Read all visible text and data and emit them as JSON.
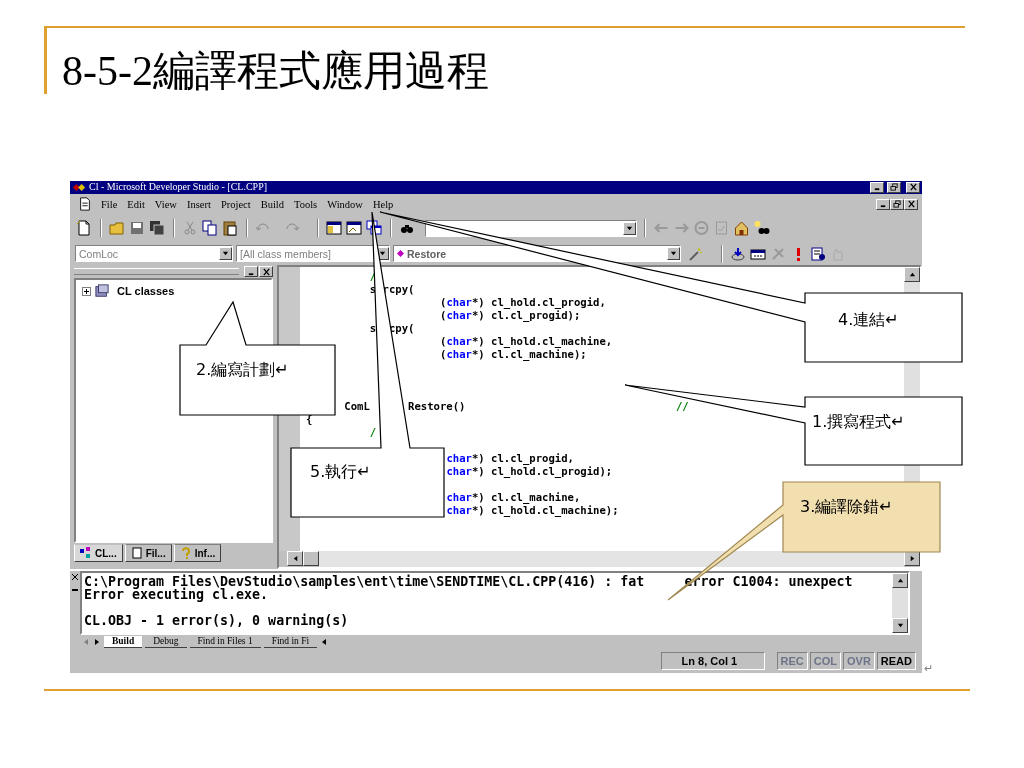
{
  "slide": {
    "title": "8-5-2編譯程式應用過程"
  },
  "window": {
    "title": "Cl - Microsoft Developer Studio - [CL.CPP]"
  },
  "menu": [
    "File",
    "Edit",
    "View",
    "Insert",
    "Project",
    "Build",
    "Tools",
    "Window",
    "Help"
  ],
  "combos": [
    {
      "value": "ComLoc"
    },
    {
      "value": "[All class members]"
    },
    {
      "value": "Restore"
    }
  ],
  "workspace": {
    "tree": [
      {
        "label": "CL classes",
        "expanded": false
      }
    ],
    "tabs": [
      {
        "label": "CL...",
        "selected": true
      },
      {
        "label": "Fil...",
        "selected": false
      },
      {
        "label": "Inf...",
        "selected": false
      }
    ]
  },
  "editor": {
    "lines": [
      {
        "kind": "code",
        "parts": [
          {
            "text": "          /",
            "kind": "comment"
          }
        ]
      },
      {
        "kind": "code",
        "parts": [
          {
            "text": "          s rcpy(",
            "kind": "plain"
          }
        ]
      },
      {
        "kind": "code",
        "parts": [
          {
            "text": "                     (",
            "kind": "plain"
          },
          {
            "text": "char",
            "kind": "keyword"
          },
          {
            "text": "*) cl_hold.cl_progid,",
            "kind": "plain"
          }
        ]
      },
      {
        "kind": "code",
        "parts": [
          {
            "text": "                     (",
            "kind": "plain"
          },
          {
            "text": "char",
            "kind": "keyword"
          },
          {
            "text": "*) cl.cl_progid);",
            "kind": "plain"
          }
        ]
      },
      {
        "kind": "code",
        "parts": [
          {
            "text": "          s  cpy(",
            "kind": "plain"
          }
        ]
      },
      {
        "kind": "code",
        "parts": [
          {
            "text": "                     (",
            "kind": "plain"
          },
          {
            "text": "char",
            "kind": "keyword"
          },
          {
            "text": "*) cl_hold.cl_machine,",
            "kind": "plain"
          }
        ]
      },
      {
        "kind": "code",
        "parts": [
          {
            "text": "                     (",
            "kind": "plain"
          },
          {
            "text": "char",
            "kind": "keyword"
          },
          {
            "text": "*) cl.cl_machine);",
            "kind": "plain"
          }
        ]
      },
      {
        "kind": "blank"
      },
      {
        "kind": "blank"
      },
      {
        "kind": "blank"
      },
      {
        "kind": "code",
        "parts": [
          {
            "text": "      ComL      Restore()                                 ",
            "kind": "plain"
          },
          {
            "text": "//",
            "kind": "comment"
          }
        ]
      },
      {
        "kind": "code",
        "parts": [
          {
            "text": "{",
            "kind": "plain"
          }
        ]
      },
      {
        "kind": "code",
        "parts": [
          {
            "text": "          /",
            "kind": "comment"
          }
        ]
      },
      {
        "kind": "blank"
      },
      {
        "kind": "code",
        "parts": [
          {
            "text": "                      char",
            "kind": "keyword"
          },
          {
            "text": "*) cl.cl_progid,",
            "kind": "plain"
          }
        ]
      },
      {
        "kind": "code",
        "parts": [
          {
            "text": "                      char",
            "kind": "keyword"
          },
          {
            "text": "*) cl_hold.cl_progid);",
            "kind": "plain"
          }
        ]
      },
      {
        "kind": "blank"
      },
      {
        "kind": "code",
        "parts": [
          {
            "text": "                      char",
            "kind": "keyword"
          },
          {
            "text": "*) cl.cl_machine,",
            "kind": "plain"
          }
        ]
      },
      {
        "kind": "code",
        "parts": [
          {
            "text": "                      char",
            "kind": "keyword"
          },
          {
            "text": "*) cl_hold.cl_machine);",
            "kind": "plain"
          }
        ]
      }
    ]
  },
  "output": {
    "lines": [
      {
        "kind": "text",
        "text": "C:\\Program Files\\DevStudio\\samples\\ent\\time\\SENDTIME\\CL.CPP(416) : fat     error C1004: unexpect"
      },
      {
        "kind": "text",
        "text": "Error executing cl.exe."
      },
      {
        "kind": "blank"
      },
      {
        "kind": "text",
        "text": "CL.OBJ - 1 error(s), 0 warning(s)"
      }
    ],
    "tabs": [
      {
        "label": "Build",
        "selected": true
      },
      {
        "label": "Debug",
        "selected": false
      },
      {
        "label": "Find in Files 1",
        "selected": false
      },
      {
        "label": "Find in Fi",
        "selected": false
      }
    ]
  },
  "status_bar": {
    "position": "Ln 8, Col 1",
    "indicators": [
      {
        "label": "REC",
        "disabled": true
      },
      {
        "label": "COL",
        "disabled": true
      },
      {
        "label": "OVR",
        "disabled": true
      },
      {
        "label": "READ",
        "disabled": false
      }
    ],
    "end_mark": "↵"
  },
  "callouts": [
    {
      "text": "4.連結↵",
      "kind": "plain"
    },
    {
      "text": "2.編寫計劃↵",
      "kind": "plain"
    },
    {
      "text": "1.撰寫程式↵",
      "kind": "plain"
    },
    {
      "text": "5.執行↵",
      "kind": "plain"
    },
    {
      "text": "3.編譯除錯↵",
      "kind": "highlight"
    }
  ]
}
